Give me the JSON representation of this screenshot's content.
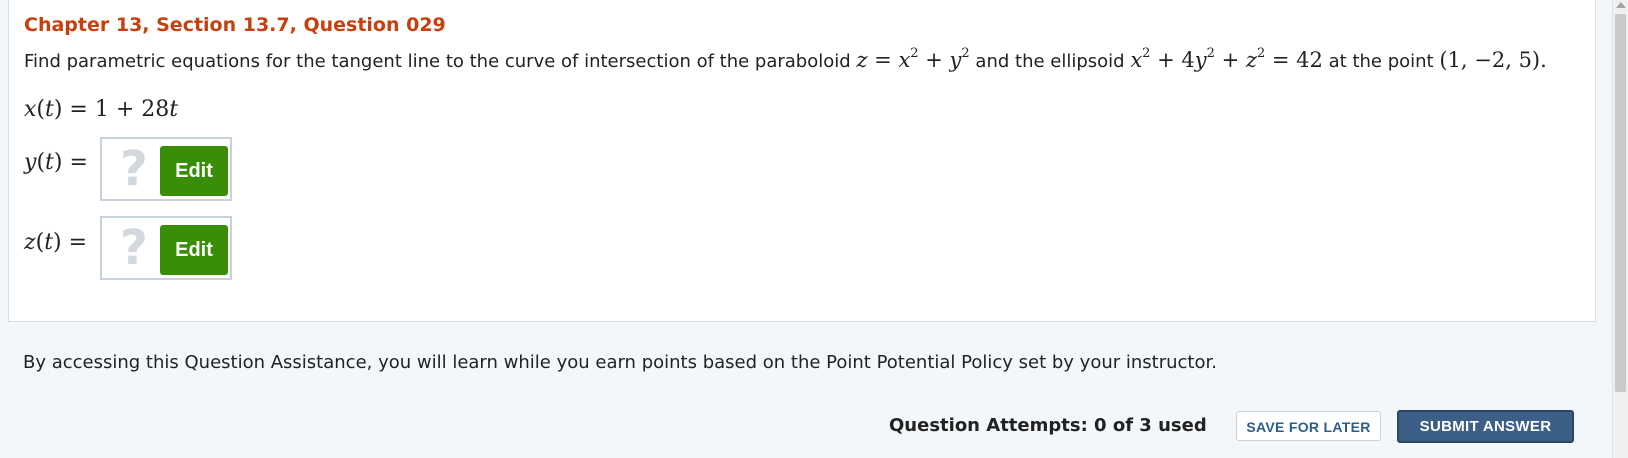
{
  "header": {
    "title": "Chapter 13, Section 13.7, Question 029"
  },
  "question": {
    "text_before": "Find parametric equations for the tangent line to the curve of intersection of the paraboloid",
    "paraboloid_eq": "z = x² + y²",
    "text_mid": "and the ellipsoid",
    "ellipsoid_eq": "x² + 4y² + z² = 42",
    "text_after": "at the point",
    "point": "(1, −2, 5)."
  },
  "answers": {
    "x_label": "x(t) =",
    "x_value": "1 + 28t",
    "y_label": "y(t) =",
    "z_label": "z(t) =",
    "placeholder_symbol": "?",
    "edit_label": "Edit"
  },
  "footer": {
    "assistance_text": "By accessing this Question Assistance, you will learn while you earn points based on the Point Potential Policy set by your instructor.",
    "attempts_text": "Question Attempts: 0 of 3 used",
    "save_label": "SAVE FOR LATER",
    "submit_label": "SUBMIT ANSWER"
  },
  "colors": {
    "title": "#c6400f",
    "edit_button": "#3a8d06",
    "submit_button": "#3b5f86",
    "save_text": "#2d5d8a"
  },
  "icons": {
    "placeholder": "question-mark-icon",
    "scroll_up": "scroll-up-arrow-icon"
  }
}
